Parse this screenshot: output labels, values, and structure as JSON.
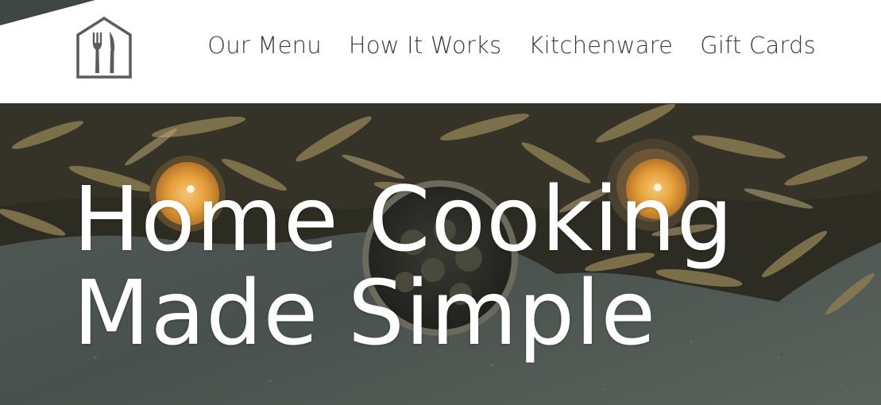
{
  "colors": {
    "header_bg": "#ffffff",
    "nav_text": "#3d3a31",
    "logo_stroke": "#5a5d5c",
    "hero_title": "#ffffff",
    "hero_table_slate": "#4b5450",
    "candle_glow": "#e8a23a"
  },
  "header": {
    "logo_icon": "house-fork-knife-icon",
    "nav": [
      {
        "label": "Our Menu"
      },
      {
        "label": "How It Works"
      },
      {
        "label": "Kitchenware"
      },
      {
        "label": "Gift Cards"
      }
    ]
  },
  "hero": {
    "title_line_1": "Home Cooking",
    "title_line_2": "Made Simple"
  }
}
